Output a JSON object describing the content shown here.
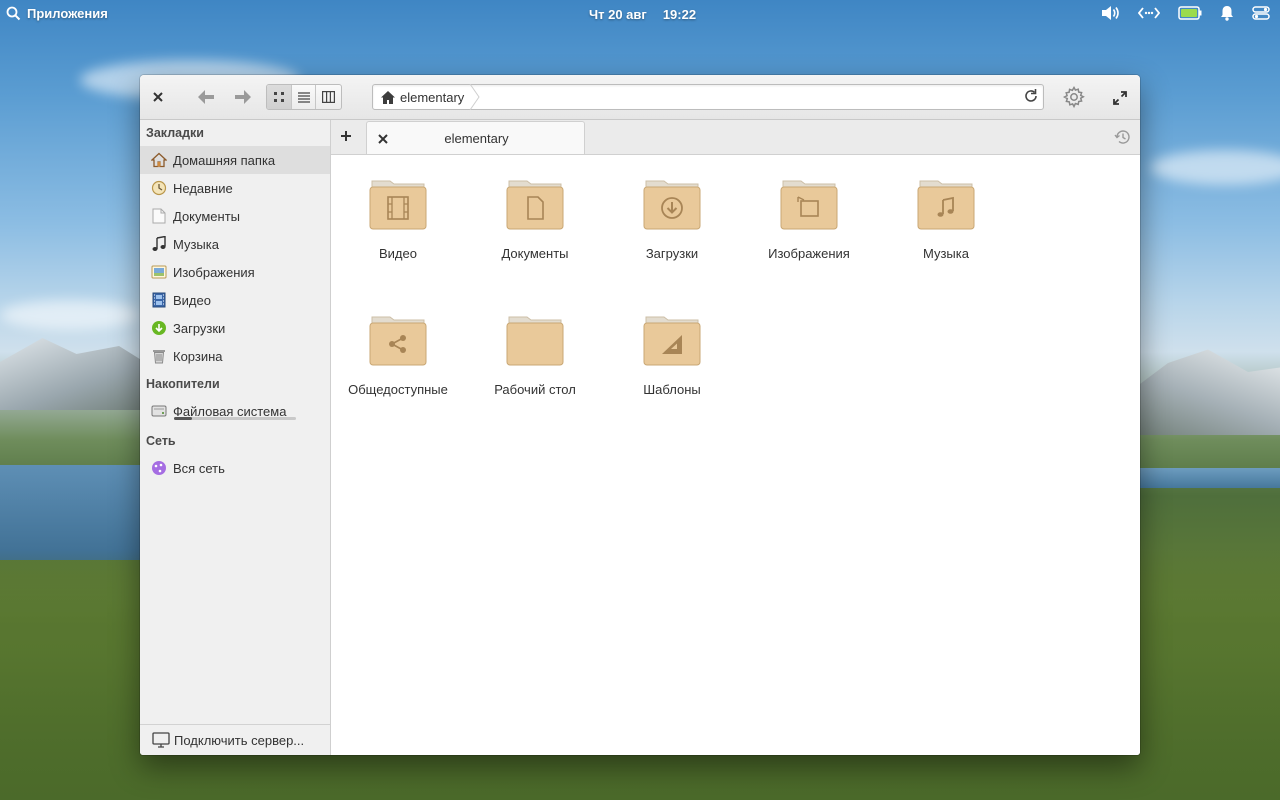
{
  "panel": {
    "apps_label": "Приложения",
    "date": "Чт 20 авг",
    "time": "19:22",
    "indicators": [
      "volume-icon",
      "network-icon",
      "battery-icon",
      "notifications-icon",
      "session-icon"
    ]
  },
  "window": {
    "pathbar": {
      "crumb": "elementary"
    },
    "view_modes": [
      "grid",
      "list",
      "columns"
    ],
    "active_view": "grid"
  },
  "sidebar": {
    "bookmarks_header": "Закладки",
    "bookmarks": [
      {
        "label": "Домашняя папка",
        "icon": "home-icon",
        "selected": true
      },
      {
        "label": "Недавние",
        "icon": "recent-icon"
      },
      {
        "label": "Документы",
        "icon": "document-icon"
      },
      {
        "label": "Музыка",
        "icon": "music-icon"
      },
      {
        "label": "Изображения",
        "icon": "pictures-icon"
      },
      {
        "label": "Видео",
        "icon": "video-icon"
      },
      {
        "label": "Загрузки",
        "icon": "download-icon"
      },
      {
        "label": "Корзина",
        "icon": "trash-icon"
      }
    ],
    "devices_header": "Накопители",
    "devices": [
      {
        "label": "Файловая система",
        "icon": "drive-icon",
        "usage": 0.15
      }
    ],
    "network_header": "Сеть",
    "network": [
      {
        "label": "Вся сеть",
        "icon": "network-globe-icon"
      }
    ],
    "footer": "Подключить сервер..."
  },
  "tabs": [
    {
      "title": "elementary"
    }
  ],
  "folders": [
    {
      "name": "Видео",
      "icon": "film-icon"
    },
    {
      "name": "Документы",
      "icon": "document-icon"
    },
    {
      "name": "Загрузки",
      "icon": "download-icon"
    },
    {
      "name": "Изображения",
      "icon": "pictures-icon"
    },
    {
      "name": "Музыка",
      "icon": "music-icon"
    },
    {
      "name": "Общедоступные",
      "icon": "share-icon"
    },
    {
      "name": "Рабочий стол",
      "icon": "blank-icon"
    },
    {
      "name": "Шаблоны",
      "icon": "templates-icon"
    }
  ],
  "colors": {
    "folder_body": "#e9c99a",
    "folder_back": "#e3dccf",
    "folder_glyph": "#a88556",
    "accent_green": "#68b723"
  }
}
